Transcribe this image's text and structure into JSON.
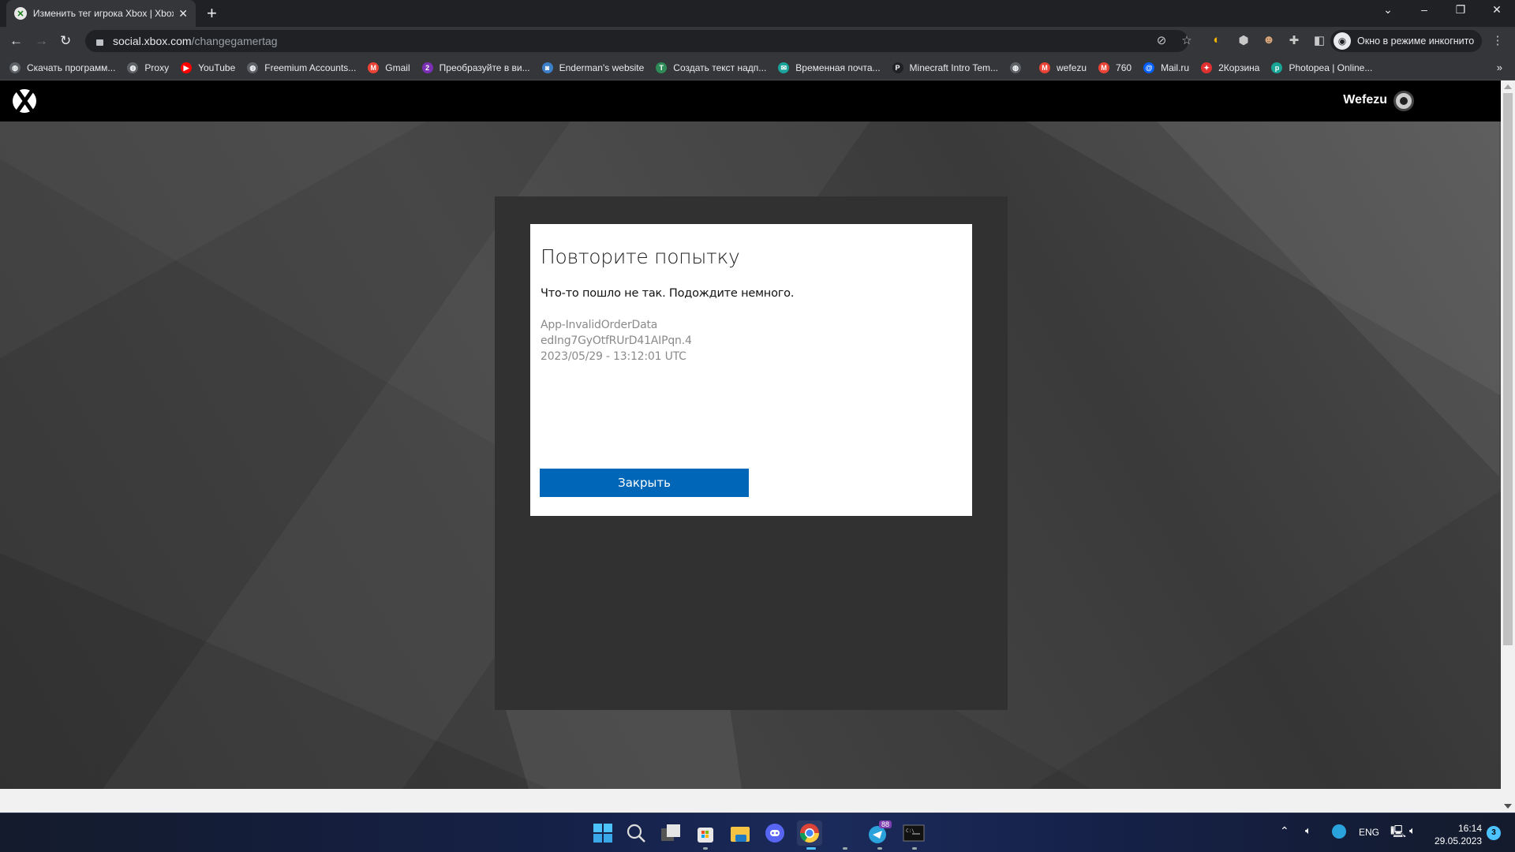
{
  "browser": {
    "tab": {
      "title": "Изменить тег игрока Xbox | Xbox",
      "favicon": "xbox-icon"
    },
    "new_tab_label": "+",
    "window_controls": {
      "minimize": "–",
      "restore": "❐",
      "close": "✕",
      "tab_search": "⌄"
    },
    "url": {
      "host": "social.xbox.com",
      "path": "/changegamertag"
    },
    "incognito_label": "Окно в режиме инкогнито",
    "extensions": [
      "eye-off-icon",
      "star-icon",
      "coin-extension-icon",
      "adblock-plus-icon",
      "avatar-extension-icon",
      "puzzle-icon",
      "sidepanel-icon"
    ],
    "bookmarks": [
      {
        "label": "Скачать программ...",
        "icon": "globe-icon",
        "color": "#5f6368"
      },
      {
        "label": "Proxy",
        "icon": "globe-icon",
        "color": "#5f6368"
      },
      {
        "label": "YouTube",
        "icon": "youtube-icon",
        "color": "#ff0000"
      },
      {
        "label": "Freemium Accounts...",
        "icon": "globe-icon",
        "color": "#5f6368"
      },
      {
        "label": "Gmail",
        "icon": "gmail-icon",
        "color": "#ea4335"
      },
      {
        "label": "Преобразуйте в ви...",
        "icon": "two-icon",
        "color": "#7b2fb5"
      },
      {
        "label": "Enderman's website",
        "icon": "computer-icon",
        "color": "#3c7fc9"
      },
      {
        "label": "Создать текст надп...",
        "icon": "text-icon",
        "color": "#2e8b57"
      },
      {
        "label": "Временная почта...",
        "icon": "mail-temp-icon",
        "color": "#1aa39b"
      },
      {
        "label": "Minecraft Intro Tem...",
        "icon": "p-icon",
        "color": "#202124"
      },
      {
        "label": "",
        "icon": "globe-icon",
        "color": "#5f6368"
      },
      {
        "label": "wefezu",
        "icon": "gmail-icon",
        "color": "#ea4335"
      },
      {
        "label": "760",
        "icon": "gmail-icon",
        "color": "#ea4335"
      },
      {
        "label": "Mail.ru",
        "icon": "mailru-icon",
        "color": "#005ff9"
      },
      {
        "label": "2Корзина",
        "icon": "star-red-icon",
        "color": "#e03030"
      },
      {
        "label": "Photopea | Online...",
        "icon": "photopea-icon",
        "color": "#18a497"
      }
    ],
    "bookmarks_more": "»"
  },
  "xbox": {
    "gamertag": "Wefezu"
  },
  "dialog": {
    "title": "Повторите попытку",
    "message": "Что-то пошло не так. Подождите немного.",
    "error_code": "App-InvalidOrderData",
    "correlation_id": "edIng7GyOtfRUrD41AIPqn.4",
    "timestamp": "2023/05/29 - 13:12:01 UTC",
    "close_label": "Закрыть",
    "accent": "#0067b8"
  },
  "taskbar": {
    "apps": [
      {
        "name": "start",
        "active": false
      },
      {
        "name": "search",
        "active": false
      },
      {
        "name": "task-view",
        "active": false
      },
      {
        "name": "microsoft-store",
        "active": false
      },
      {
        "name": "file-explorer",
        "active": false
      },
      {
        "name": "discord",
        "active": false
      },
      {
        "name": "chrome",
        "active": true
      },
      {
        "name": "blank",
        "active": false
      },
      {
        "name": "telegram",
        "active": false,
        "badge": "88"
      },
      {
        "name": "terminal",
        "active": false
      }
    ],
    "tray": {
      "language": "ENG",
      "time": "16:14",
      "date": "29.05.2023",
      "notification_count": "3"
    }
  }
}
